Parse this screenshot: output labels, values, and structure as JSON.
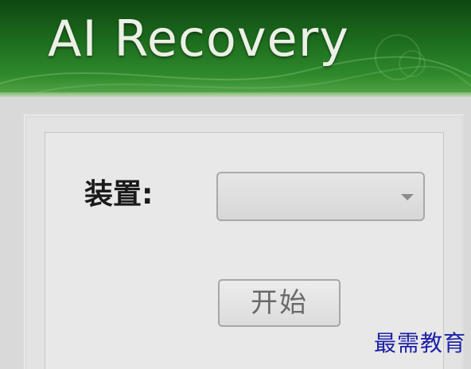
{
  "banner": {
    "title": "AI Recovery"
  },
  "form": {
    "device_label": "装置:",
    "device_select_value": "",
    "start_button_label": "开始"
  },
  "watermark": {
    "text": "最需教育"
  },
  "colors": {
    "banner_dark": "#0f4712",
    "banner_light": "#5aa84a",
    "panel_bg": "#e3e3e3",
    "watermark": "#1f22a6"
  },
  "icons": {
    "select_caret": "chevron-down-icon"
  }
}
